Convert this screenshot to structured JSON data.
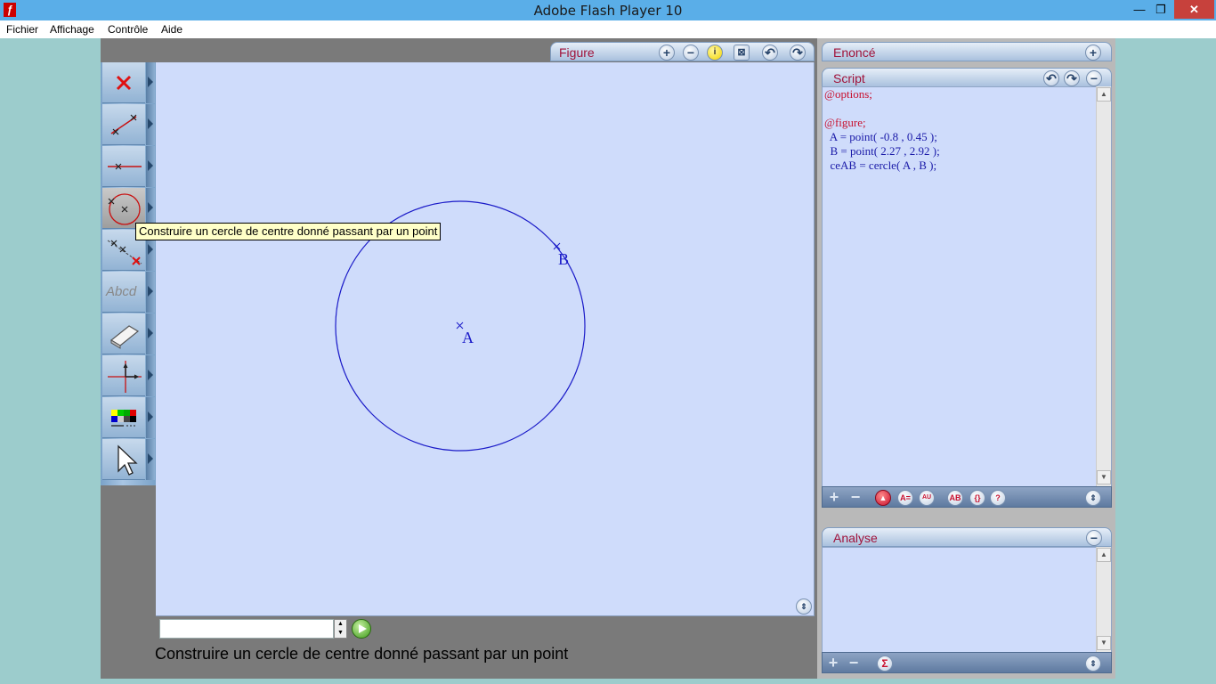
{
  "window": {
    "title": "Adobe Flash Player 10",
    "app_icon": "ƒ",
    "min": "—",
    "max": "❐",
    "close": "✕"
  },
  "menu": [
    "Fichier",
    "Affichage",
    "Contrôle",
    "Aide"
  ],
  "tools": [
    {
      "name": "delete",
      "icon": "red-x-icon"
    },
    {
      "name": "line",
      "icon": "segment-icon"
    },
    {
      "name": "line2",
      "icon": "line-icon"
    },
    {
      "name": "circle",
      "icon": "circle-icon"
    },
    {
      "name": "points",
      "icon": "points-icon"
    },
    {
      "name": "text",
      "icon": "text-icon",
      "label": "Abcd"
    },
    {
      "name": "eraser",
      "icon": "eraser-icon"
    },
    {
      "name": "axes",
      "icon": "axes-icon"
    },
    {
      "name": "colors",
      "icon": "palette-icon"
    },
    {
      "name": "pointer",
      "icon": "cursor-icon"
    }
  ],
  "figure": {
    "tab_label": "Figure",
    "points": [
      {
        "label": "A",
        "x": -0.8,
        "y": 0.45
      },
      {
        "label": "B",
        "x": 2.27,
        "y": 2.92
      }
    ],
    "colors": {
      "construction": "#1a1ac8",
      "background": "#cfdcfb"
    }
  },
  "tooltip": "Construire un cercle de centre donné passant par un point",
  "status_text": "Construire un cercle de centre donné passant par un point",
  "enonce": {
    "label": "Enoncé"
  },
  "script": {
    "label": "Script",
    "lines": [
      "@options;",
      "",
      "@figure;",
      "  A = point( -0.8 , 0.45 );",
      "  B = point( 2.27 , 2.92 );",
      "  ceAB = cercle( A , B );"
    ]
  },
  "analyse": {
    "label": "Analyse"
  }
}
